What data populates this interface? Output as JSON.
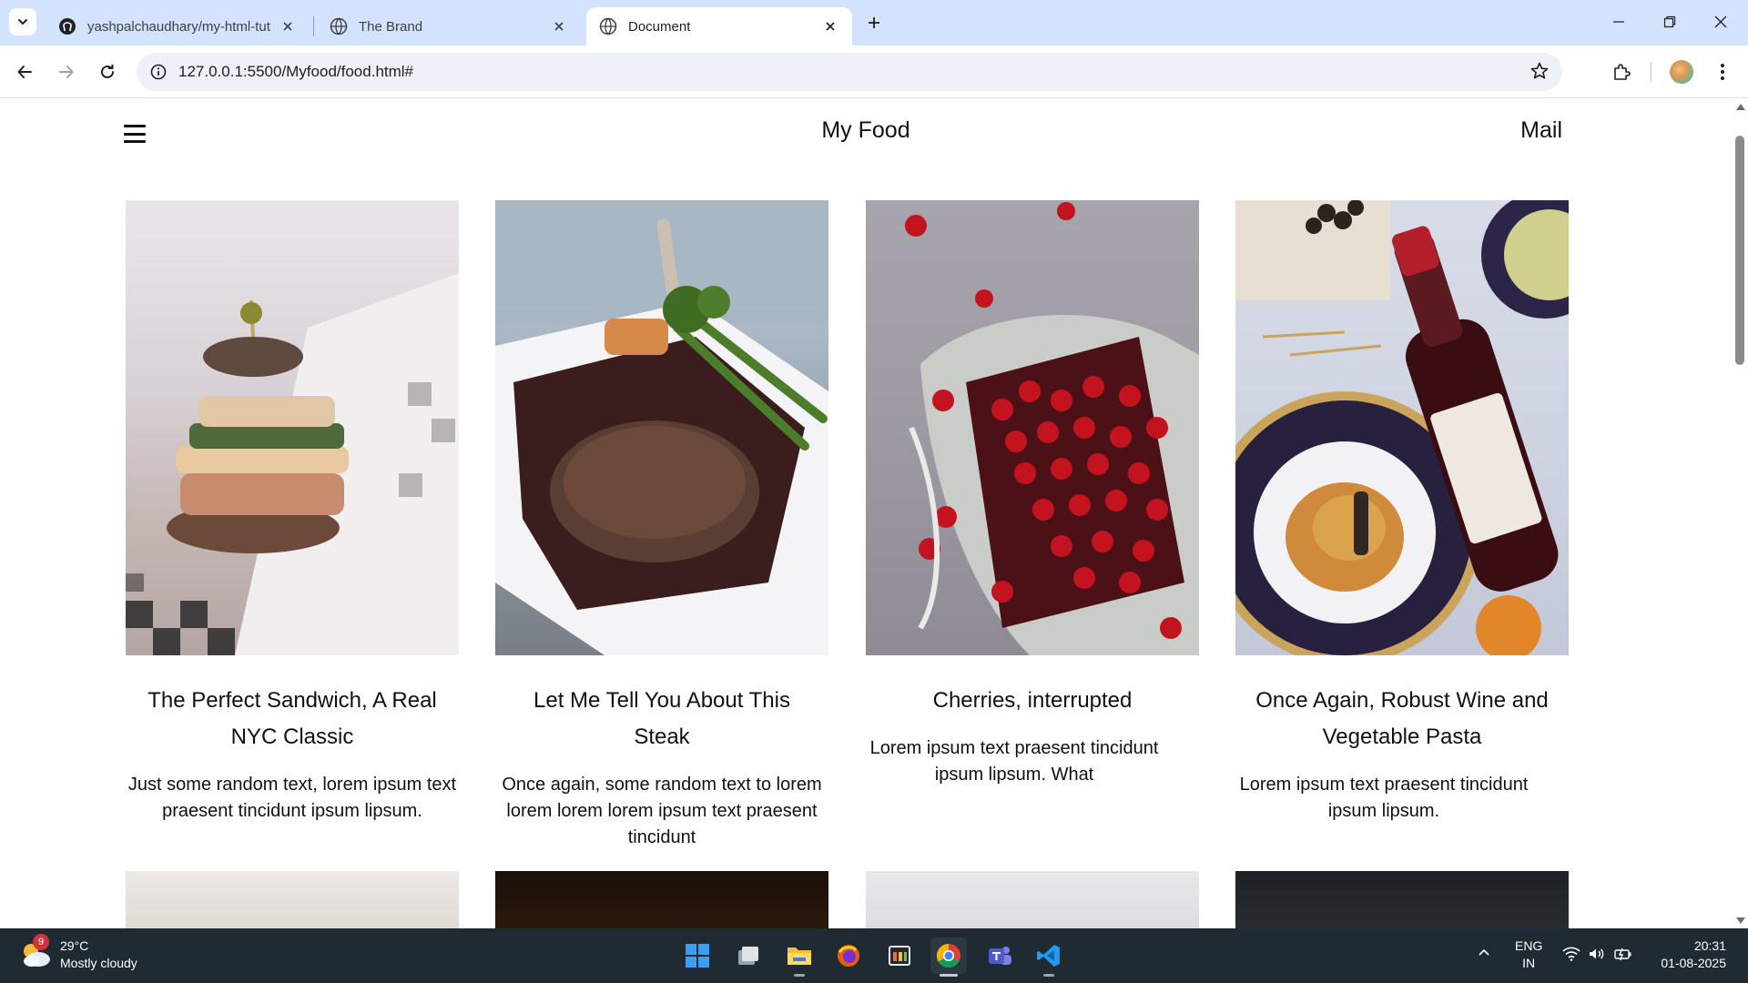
{
  "browser": {
    "tabs": [
      {
        "title": "yashpalchaudhary/my-html-tut",
        "icon": "github-icon"
      },
      {
        "title": "The Brand",
        "icon": "globe-icon"
      },
      {
        "title": "Document",
        "icon": "globe-icon",
        "active": true
      }
    ],
    "url": "127.0.0.1:5500/Myfood/food.html#"
  },
  "page": {
    "site_title": "My Food",
    "mail_label": "Mail",
    "cards": [
      {
        "title": "The Perfect Sandwich, A Real NYC Classic",
        "text": "Just some random text, lorem ipsum text praesent tincidunt ipsum lipsum.",
        "image": "sandwich-photo"
      },
      {
        "title": "Let Me Tell You About This Steak",
        "text": "Once again, some random text to lorem lorem lorem lorem ipsum text praesent tincidunt",
        "image": "steak-photo"
      },
      {
        "title": "Cherries, interrupted",
        "text": "Lorem ipsum text praesent tincidunt ipsum lipsum. What",
        "image": "cherries-photo"
      },
      {
        "title": "Once Again, Robust Wine and Vegetable Pasta",
        "text": "Lorem ipsum text praesent tincidunt ipsum lipsum.",
        "image": "wine-pasta-photo"
      }
    ]
  },
  "taskbar": {
    "weather_badge": "9",
    "temperature": "29°C",
    "condition": "Mostly cloudy",
    "language_line1": "ENG",
    "language_line2": "IN",
    "time": "20:31",
    "date": "01-08-2025"
  },
  "colors": {
    "tabstrip": "#d3e3fd",
    "taskbar": "#202a33",
    "text": "#111111"
  }
}
